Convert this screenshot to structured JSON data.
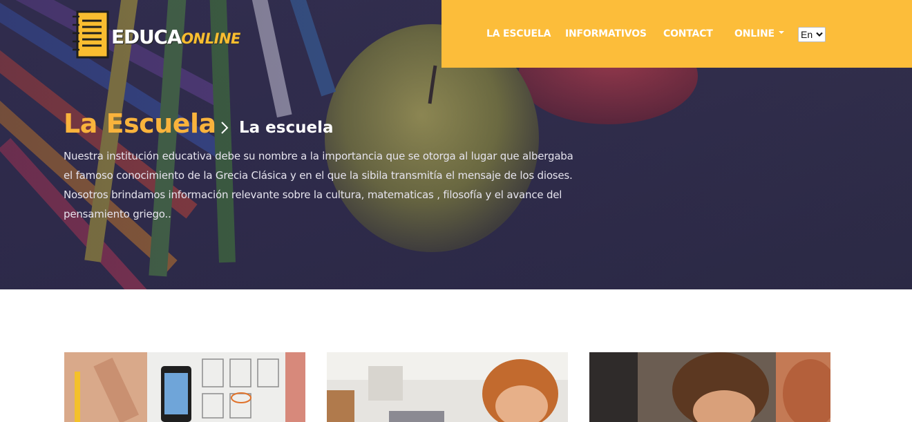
{
  "logo": {
    "part1": "EDUCA",
    "part2": "ONLINE"
  },
  "nav": {
    "items": [
      {
        "label": "LA ESCUELA"
      },
      {
        "label": "INFORMATIVOS"
      },
      {
        "label": "CONTACT"
      },
      {
        "label": "ONLINE"
      }
    ],
    "language": "En"
  },
  "hero": {
    "title": "La Escuela",
    "breadcrumb_current": "La escuela",
    "description": "Nuestra institución educativa debe su nombre a la importancia que se otorga al lugar que albergaba el famoso conocimiento de la Grecia Clásica y en el que la sibila transmitía el mensaje de los dioses. Nosotros brindamos información relevante sobre la cultura, matematicas , filosofía y el avance del pensamiento griego.."
  },
  "colors": {
    "accent": "#fcbd3a",
    "title": "#f9b33c",
    "hero_bg": "#2f2c48"
  }
}
